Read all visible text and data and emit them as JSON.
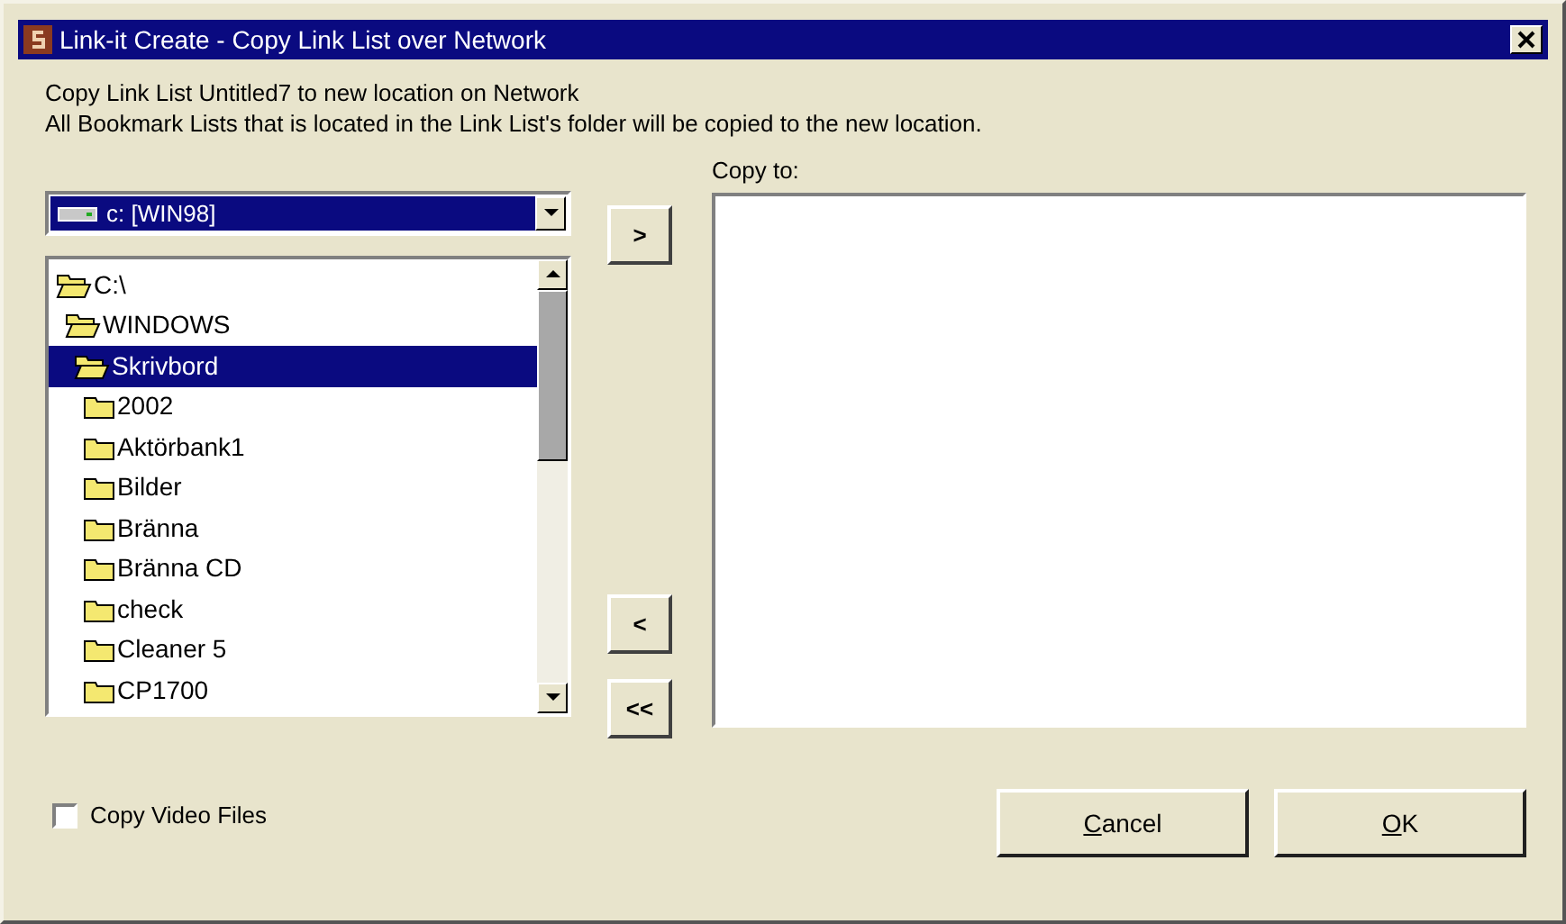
{
  "window": {
    "title": "Link-it Create - Copy Link List over Network"
  },
  "message": [
    "Copy Link List Untitled7 to new location on Network",
    "All Bookmark Lists that is located in the Link List's folder will be copied to the new location."
  ],
  "drive": {
    "value": "c: [WIN98]"
  },
  "tree": [
    {
      "label": "C:\\",
      "expanded": true,
      "selected": false,
      "children": [
        {
          "label": "WINDOWS",
          "expanded": true,
          "selected": false,
          "children": [
            {
              "label": "Skrivbord",
              "expanded": true,
              "selected": true,
              "children": [
                {
                  "label": "2002",
                  "expanded": false,
                  "selected": false
                },
                {
                  "label": "Aktörbank1",
                  "expanded": false,
                  "selected": false
                },
                {
                  "label": "Bilder",
                  "expanded": false,
                  "selected": false
                },
                {
                  "label": "Bränna",
                  "expanded": false,
                  "selected": false
                },
                {
                  "label": "Bränna CD",
                  "expanded": false,
                  "selected": false
                },
                {
                  "label": "check",
                  "expanded": false,
                  "selected": false
                },
                {
                  "label": "Cleaner 5",
                  "expanded": false,
                  "selected": false
                },
                {
                  "label": "CP1700",
                  "expanded": false,
                  "selected": false
                }
              ]
            }
          ]
        }
      ]
    }
  ],
  "move_buttons": [
    {
      "label": ">"
    },
    {
      "label": "<"
    },
    {
      "label": "<<"
    }
  ],
  "copy_to": {
    "label": "Copy to:"
  },
  "copy_video": {
    "label": "Copy Video Files",
    "checked": false
  },
  "buttons": [
    {
      "label": "Cancel",
      "underlined_first": true
    },
    {
      "label": "OK",
      "underlined_first": true
    }
  ]
}
